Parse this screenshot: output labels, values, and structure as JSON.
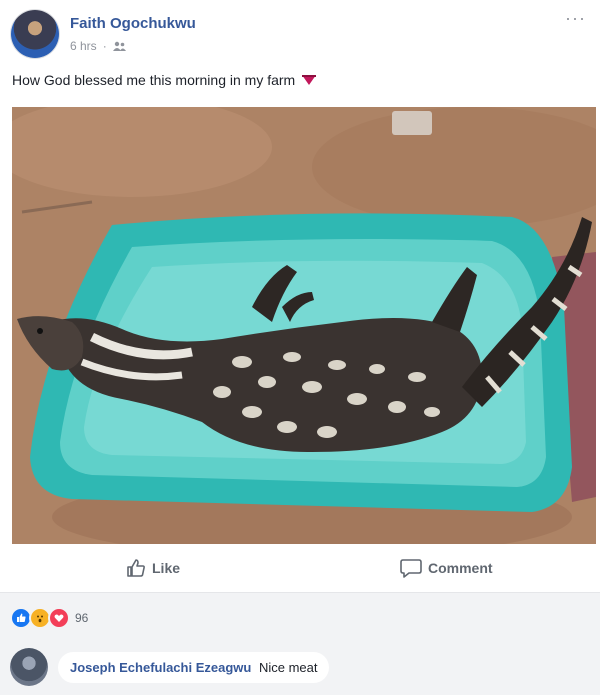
{
  "post": {
    "author": "Faith Ogochukwu",
    "time": "6 hrs",
    "more": "···",
    "text": "How God blessed me this morning in my farm"
  },
  "actions": {
    "like_label": "Like",
    "comment_label": "Comment"
  },
  "reactions": {
    "count": "96",
    "types": [
      "like",
      "wow",
      "love"
    ]
  },
  "comment": {
    "author": "Joseph Echefulachi Ezeagwu",
    "text": "Nice meat"
  },
  "colors": {
    "link_blue": "#365899",
    "like_blue": "#1877f2",
    "love_red": "#f33e58",
    "wow_yellow": "#f7b125",
    "tub_turquoise": "#2fb8b3"
  }
}
